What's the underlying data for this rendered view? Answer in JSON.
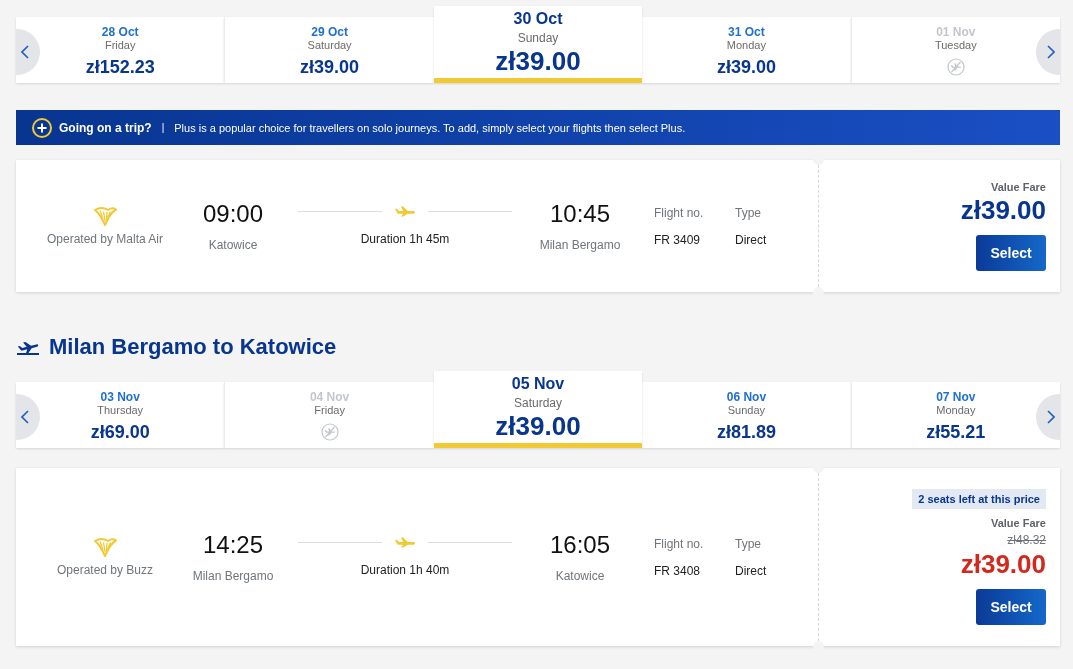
{
  "outbound_dates": {
    "tiles": [
      {
        "date": "28 Oct",
        "day": "Friday",
        "price": "zł152.23",
        "selected": false,
        "disabled": false
      },
      {
        "date": "29 Oct",
        "day": "Saturday",
        "price": "zł39.00",
        "selected": false,
        "disabled": false
      },
      {
        "date": "30 Oct",
        "day": "Sunday",
        "price": "zł39.00",
        "selected": true,
        "disabled": false
      },
      {
        "date": "31 Oct",
        "day": "Monday",
        "price": "zł39.00",
        "selected": false,
        "disabled": false
      },
      {
        "date": "01 Nov",
        "day": "Tuesday",
        "selected": false,
        "disabled": true
      }
    ]
  },
  "banner": {
    "title": "Going on a trip?",
    "separator": "|",
    "text": "Plus is a popular choice for travellers on solo journeys. To add, simply select your flights then select Plus."
  },
  "outbound_flights": [
    {
      "operator": "Operated by Malta Air",
      "departure_time": "09:00",
      "departure_airport": "Katowice",
      "duration": "Duration 1h 45m",
      "arrival_time": "10:45",
      "arrival_airport": "Milan Bergamo",
      "flight_no_label": "Flight no.",
      "flight_no": "FR 3409",
      "type_label": "Type",
      "type": "Direct",
      "fare_name": "Value Fare",
      "price": "zł39.00",
      "discounted": false,
      "button": "Select"
    }
  ],
  "return_header": {
    "title": "Milan Bergamo to Katowice"
  },
  "return_dates": {
    "tiles": [
      {
        "date": "03 Nov",
        "day": "Thursday",
        "price": "zł69.00",
        "selected": false,
        "disabled": false
      },
      {
        "date": "04 Nov",
        "day": "Friday",
        "selected": false,
        "disabled": true
      },
      {
        "date": "05 Nov",
        "day": "Saturday",
        "price": "zł39.00",
        "selected": true,
        "disabled": false
      },
      {
        "date": "06 Nov",
        "day": "Sunday",
        "price": "zł81.89",
        "selected": false,
        "disabled": false
      },
      {
        "date": "07 Nov",
        "day": "Monday",
        "price": "zł55.21",
        "selected": false,
        "disabled": false
      }
    ]
  },
  "return_flights": [
    {
      "operator": "Operated by Buzz",
      "departure_time": "14:25",
      "departure_airport": "Milan Bergamo",
      "duration": "Duration 1h 40m",
      "arrival_time": "16:05",
      "arrival_airport": "Katowice",
      "flight_no_label": "Flight no.",
      "flight_no": "FR 3408",
      "type_label": "Type",
      "type": "Direct",
      "badge": "2 seats left at this price",
      "fare_name": "Value Fare",
      "old_price": "zł48.32",
      "price": "zł39.00",
      "discounted": true,
      "button": "Select"
    }
  ]
}
